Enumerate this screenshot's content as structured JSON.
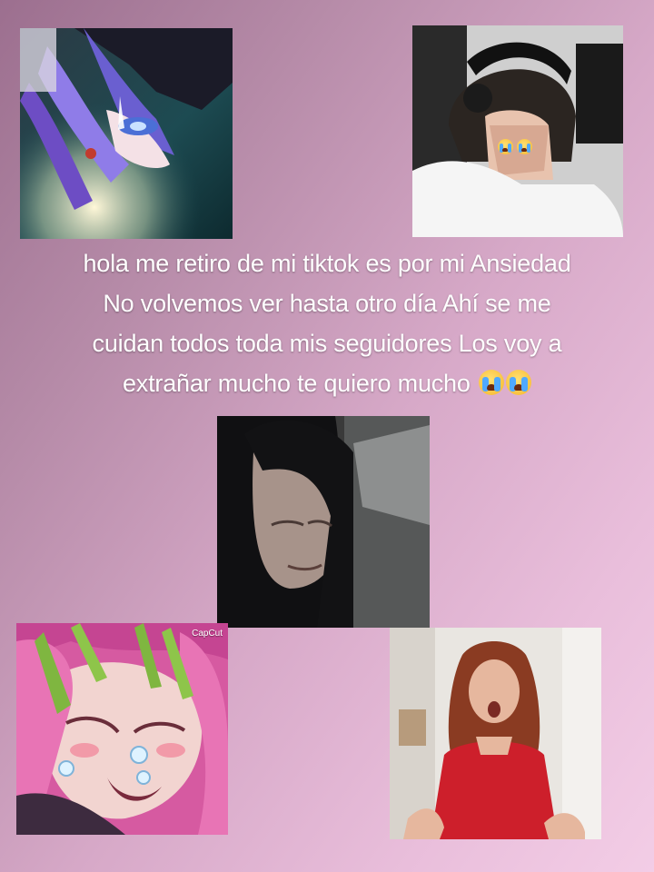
{
  "caption": {
    "lines": [
      "hola me retiro de mi tiktok es por mi Ansiedad",
      "No volvemos ver hasta otro día Ahí se me",
      "cuidan todos toda mis seguidores Los  voy a",
      "extrañar mucho te quiero mucho"
    ],
    "end_emoji": "loudly-crying-face-icon"
  },
  "images": {
    "top_left": {
      "label": "anime crying purple-hair"
    },
    "top_right": {
      "label": "person with headphones crying"
    },
    "center": {
      "label": "woman crying in car"
    },
    "bottom_left": {
      "label": "anime crying green-pink hair",
      "watermark": "CapCut"
    },
    "bottom_right": {
      "label": "woman in red shirt"
    }
  }
}
